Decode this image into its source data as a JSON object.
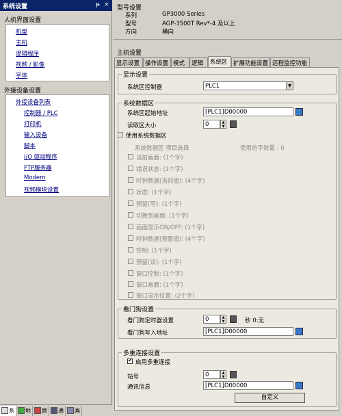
{
  "left_panel": {
    "title": "系统设置",
    "title_pin": "ᵽ",
    "title_close": "×",
    "hmi_group": "人机界面设置",
    "hmi_items": [
      "机型",
      "主机",
      "逻辑程序",
      "视频 / 影像",
      "字体"
    ],
    "ext_group": "外接设备设置",
    "ext_list_title": "外接设备列表",
    "ext_items": [
      "控制器 / PLC",
      "打印机",
      "输入设备",
      "脚本",
      "I/O 驱动程序",
      "FTP服务器",
      "Modem",
      "视频模块设置"
    ],
    "bottom_tabs": [
      "系",
      "地",
      "颜",
      "通",
      "画"
    ]
  },
  "model": {
    "title": "型号设置",
    "series_label": "系列",
    "series_value": "GP3000 Series",
    "model_label": "型号",
    "model_value": "AGP-3500T  Rev*-4 及以上",
    "orient_label": "方向",
    "orient_value": "横向"
  },
  "host": {
    "title": "主机设置",
    "tabs": [
      "显示设置",
      "操作设置",
      "模式",
      "逻辑",
      "系统区",
      "扩展功能设置",
      "远程监控功能"
    ],
    "active_tab": 4
  },
  "display": {
    "title": "显示设置",
    "ctrl_label": "系统区控制器",
    "ctrl_value": "PLC1"
  },
  "sysdata": {
    "title": "系统数据区",
    "start_label": "系统区起始地址",
    "start_value": "[PLC1]D00000",
    "read_label": "读取区大小",
    "read_value": "0",
    "use_label": "使用系统数据区",
    "item_sel_label": "系统数据区 项目选择",
    "used_label": "使用的字数量 : 0",
    "items": [
      "当前画面: (1个字)",
      "错误状态: (1个字)",
      "时钟数据(当前值): (4个字)",
      "状态: (1个字)",
      "预留(写): (1个字)",
      "切换到画面: (1个字)",
      "画面显示ON/OFF: (1个字)",
      "时钟数据(预置值): (4个字)",
      "控制: (1个字)",
      "预留(读): (1个字)",
      "窗口控制: (1个字)",
      "窗口画面: (1个字)",
      "窗口显示位置: (2个字)"
    ]
  },
  "watchdog": {
    "title": "看门狗设置",
    "timer_label": "看门狗定时器设置",
    "timer_value": "0",
    "timer_unit": "秒 0:无",
    "addr_label": "看门狗写入地址",
    "addr_value": "[PLC1]D00000"
  },
  "multi": {
    "title": "多重连接设置",
    "enable_label": "启用多重连接",
    "station_label": "站号",
    "station_value": "0",
    "comm_label": "通讯信息",
    "comm_value": "[PLC1]D00000",
    "custom_btn": "自定义"
  },
  "colors": {
    "title_bar": "#0a246a",
    "link": "#000080",
    "browse": "#3a78c8"
  }
}
